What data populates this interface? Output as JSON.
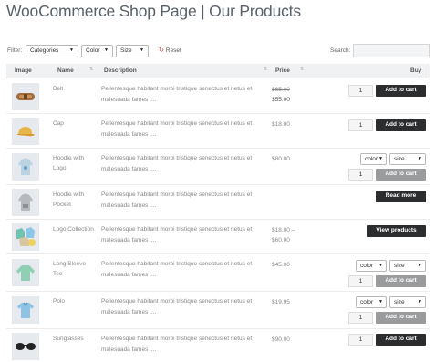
{
  "page": {
    "title": "WooCommerce Shop Page | Our Products"
  },
  "filters": {
    "label": "Filter:",
    "categories": "Categories",
    "color": "Color",
    "size": "Size",
    "reset": "Reset",
    "search_label": "Search:",
    "search_value": ""
  },
  "table": {
    "headers": {
      "image": "Image",
      "name": "Name",
      "description": "Description",
      "price": "Price",
      "buy": "Buy"
    },
    "rows": [
      {
        "name": "Belt",
        "description": "Pellentesque habitant morbi tristique senectus et netus et malesuada fames ....",
        "price_old": "$65.00",
        "price": "$55.00",
        "qty": "1",
        "button": "Add to cart",
        "image_icon": "belt-icon"
      },
      {
        "name": "Cap",
        "description": "Pellentesque habitant morbi tristique senectus et netus et malesuada fames ....",
        "price": "$18.00",
        "qty": "1",
        "button": "Add to cart",
        "image_icon": "cap-icon"
      },
      {
        "name": "Hoodie with Logo",
        "description": "Pellentesque habitant morbi tristique senectus et netus et malesuada fames ....",
        "price": "$80.00",
        "color": "color",
        "size": "size",
        "qty": "1",
        "button": "Add to cart",
        "image_icon": "hoodie-icon"
      },
      {
        "name": "Hoodie with Pocket",
        "description": "Pellentesque habitant morbi tristique senectus et netus et malesuada fames ....",
        "price": "",
        "button": "Read more",
        "image_icon": "hoodie-icon"
      },
      {
        "name": "Logo Collection",
        "description": "Pellentesque habitant morbi tristique senectus et netus et malesuada fames ....",
        "price": "$18.00 – $60.00",
        "button": "View products",
        "image_icon": "collection-icon"
      },
      {
        "name": "Long Sleeve Tee",
        "description": "Pellentesque habitant morbi tristique senectus et netus et malesuada fames ....",
        "price": "$45.00",
        "color": "color",
        "size": "size",
        "qty": "1",
        "button": "Add to cart",
        "image_icon": "tee-icon"
      },
      {
        "name": "Polo",
        "description": "Pellentesque habitant morbi tristique senectus et netus et malesuada fames ....",
        "price": "$19.95",
        "color": "color",
        "size": "size",
        "qty": "1",
        "button": "Add to cart",
        "image_icon": "polo-icon"
      },
      {
        "name": "Sunglasses",
        "description": "Pellentesque habitant morbi tristique senectus et netus et malesuada fames ....",
        "price": "$90.00",
        "qty": "1",
        "button": "Add to cart",
        "image_icon": "sunglasses-icon"
      }
    ]
  },
  "colors": {
    "button_dark": "#2b2d2f",
    "button_disabled": "#9a9b9d",
    "header_bg": "#f0f1f3",
    "reset_icon": "#c2403b"
  }
}
